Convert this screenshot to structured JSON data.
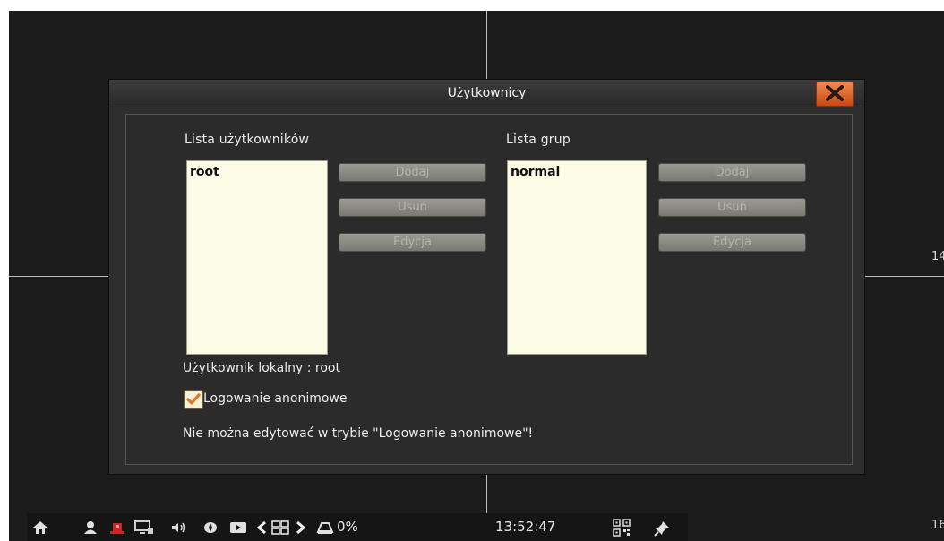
{
  "dialog": {
    "title": "Użytkownicy",
    "close_icon": "close-x-icon"
  },
  "users": {
    "label": "Lista użytkowników",
    "items": [
      "root"
    ],
    "buttons": {
      "add": "Dodaj",
      "remove": "Usuń",
      "edit": "Edycja"
    }
  },
  "groups": {
    "label": "Lista grup",
    "items": [
      "normal"
    ],
    "buttons": {
      "add": "Dodaj",
      "remove": "Usuń",
      "edit": "Edycja"
    }
  },
  "local_user": "Użytkownik lokalny : root",
  "anonymous_login": {
    "label": "Logowanie anonimowe",
    "checked": true
  },
  "warning": "Nie można edytować w trybie \"Logowanie anonimowe\"!",
  "channel_labels": [
    "14",
    "16"
  ],
  "taskbar": {
    "icons": [
      "home-icon",
      "user-icon",
      "alarm-icon",
      "display-icon",
      "speaker-icon",
      "ptz-icon",
      "playback-icon",
      "prev-icon",
      "grid-layout-icon",
      "next-icon",
      "hdd-icon",
      "qr-code-icon",
      "pin-icon"
    ],
    "hdd_usage": "0%",
    "time": "13:52:47"
  },
  "colors": {
    "background": "#1b1b1b",
    "dialog": "#2e2e2e",
    "listbox": "#fbfbe6",
    "close_button": "#d9571e",
    "button_disabled": "#8a8a82"
  }
}
